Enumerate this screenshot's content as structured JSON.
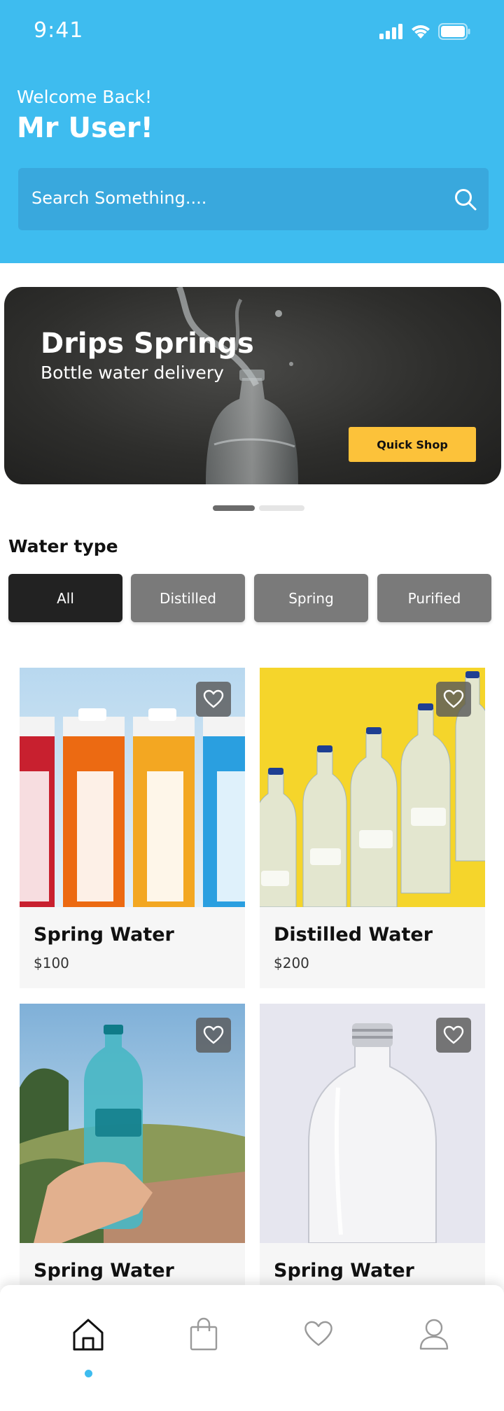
{
  "status_bar": {
    "time": "9:41"
  },
  "header": {
    "welcome": "Welcome Back!",
    "user_name": "Mr User!",
    "search_placeholder": "Search Something...."
  },
  "banner": {
    "title": "Drips Springs",
    "subtitle": "Bottle water delivery",
    "button_label": "Quick Shop",
    "carousel_pages": 2,
    "carousel_active_index": 0
  },
  "water_type": {
    "title": "Water type",
    "chips": [
      {
        "label": "All",
        "active": true
      },
      {
        "label": "Distilled",
        "active": false
      },
      {
        "label": "Spring",
        "active": false
      },
      {
        "label": "Purified",
        "active": false
      }
    ]
  },
  "products": [
    {
      "name": "Spring Water",
      "price": "$100"
    },
    {
      "name": "Distilled Water",
      "price": "$200"
    },
    {
      "name": "Spring Water",
      "price": ""
    },
    {
      "name": "Spring Water",
      "price": ""
    }
  ],
  "bottom_nav": {
    "items": [
      {
        "icon": "home-icon",
        "active": true
      },
      {
        "icon": "shopping-bag-icon",
        "active": false
      },
      {
        "icon": "heart-icon",
        "active": false
      },
      {
        "icon": "user-icon",
        "active": false
      }
    ]
  },
  "colors": {
    "header": "#3ebcef",
    "search": "#39a8dd",
    "quick_shop": "#fcc23a",
    "chip_active": "#222222",
    "chip_inactive": "#7a7a7a",
    "nav_indicator": "#3ebcef"
  }
}
